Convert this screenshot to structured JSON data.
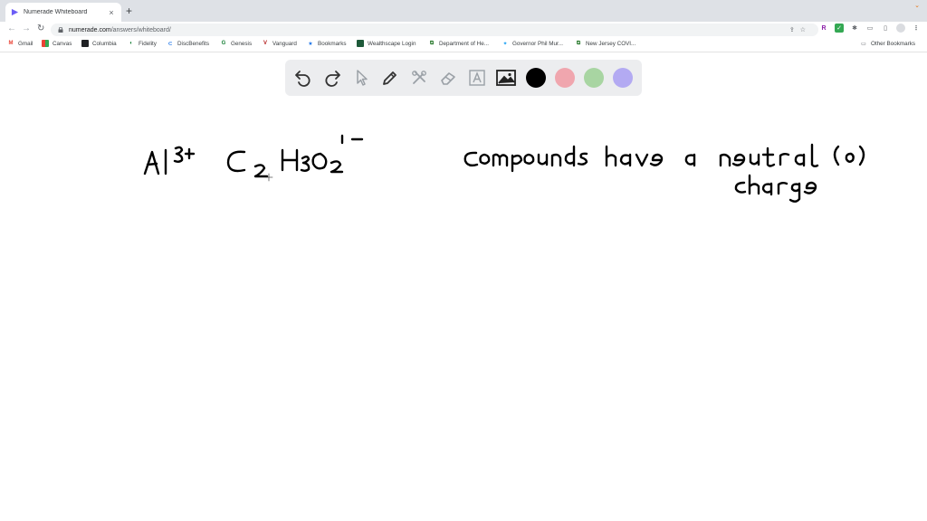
{
  "browser": {
    "tab_title": "Numerade Whiteboard",
    "tab_close": "×",
    "new_tab": "+",
    "url_host": "numerade.com",
    "url_path": "/answers/whiteboard/"
  },
  "bookmarks": [
    {
      "label": "Gmail",
      "icon": "gmail-icon",
      "color": "#ea4335"
    },
    {
      "label": "Canvas",
      "icon": "canvas-icon",
      "color": "#34a853"
    },
    {
      "label": "Columbia",
      "icon": "columbia-icon",
      "color": "#202124"
    },
    {
      "label": "Fidelity",
      "icon": "fidelity-icon",
      "color": "#188038"
    },
    {
      "label": "DiscBenefits",
      "icon": "discbenefits-icon",
      "color": "#1a73e8"
    },
    {
      "label": "Genesis",
      "icon": "genesis-icon",
      "color": "#188038"
    },
    {
      "label": "Vanguard",
      "icon": "vanguard-icon",
      "color": "#b31b1b"
    },
    {
      "label": "Bookmarks",
      "icon": "star-icon",
      "color": "#1a73e8"
    },
    {
      "label": "Wealthscape Login",
      "icon": "wealthscape-icon",
      "color": "#1e5a3a"
    },
    {
      "label": "Department of He...",
      "icon": "nj-icon",
      "color": "#2e7d32"
    },
    {
      "label": "Governor Phil Mur...",
      "icon": "twitter-icon",
      "color": "#1da1f2"
    },
    {
      "label": "New Jersey COVI...",
      "icon": "nj-icon",
      "color": "#2e7d32"
    }
  ],
  "other_bookmarks": "Other Bookmarks",
  "toolbar": {
    "tools": [
      "undo-icon",
      "redo-icon",
      "pointer-icon",
      "pen-icon",
      "tools-icon",
      "eraser-icon",
      "text-icon",
      "image-icon"
    ],
    "colors": [
      "#000000",
      "#f0a6ae",
      "#a8d5a2",
      "#b3aaf2"
    ]
  }
}
